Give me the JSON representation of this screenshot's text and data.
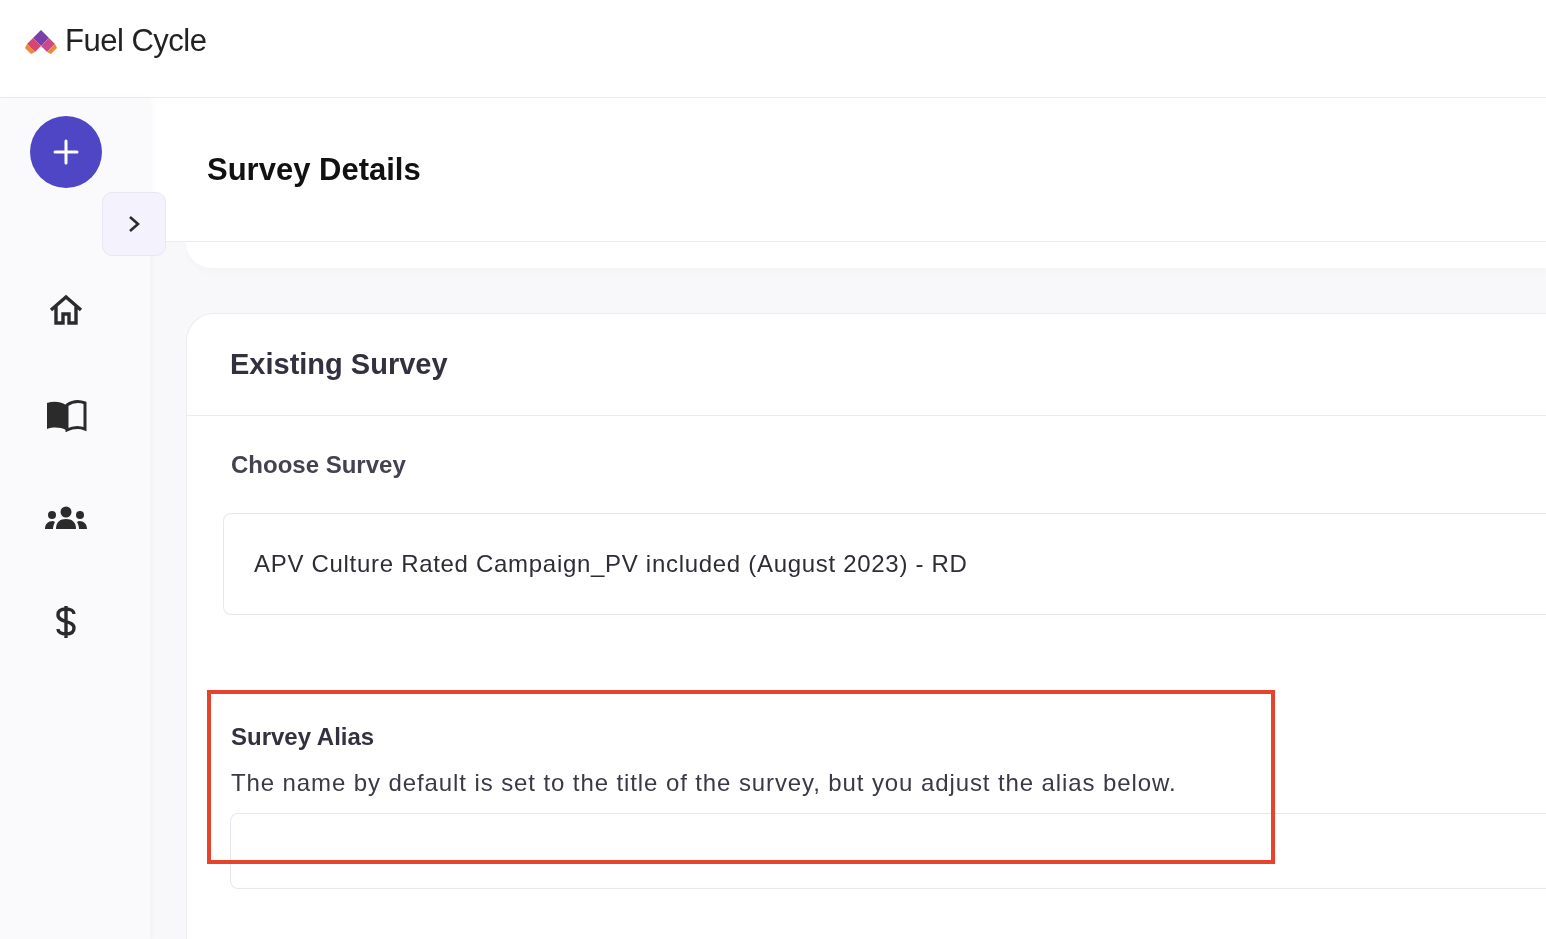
{
  "brand": {
    "name": "Fuel Cycle"
  },
  "sidebar": {
    "items": [
      {
        "kind": "home"
      },
      {
        "kind": "book"
      },
      {
        "kind": "people"
      },
      {
        "kind": "dollar"
      }
    ]
  },
  "page": {
    "title": "Survey Details"
  },
  "card": {
    "title": "Existing Survey",
    "choose": {
      "label": "Choose Survey",
      "value": "APV Culture Rated Campaign_PV included (August 2023) - RD"
    },
    "alias": {
      "label": "Survey Alias",
      "description": "The name by default is set to the title of the survey, but you adjust the alias below."
    }
  },
  "annotations": [
    {
      "kind": "rectangle"
    }
  ]
}
